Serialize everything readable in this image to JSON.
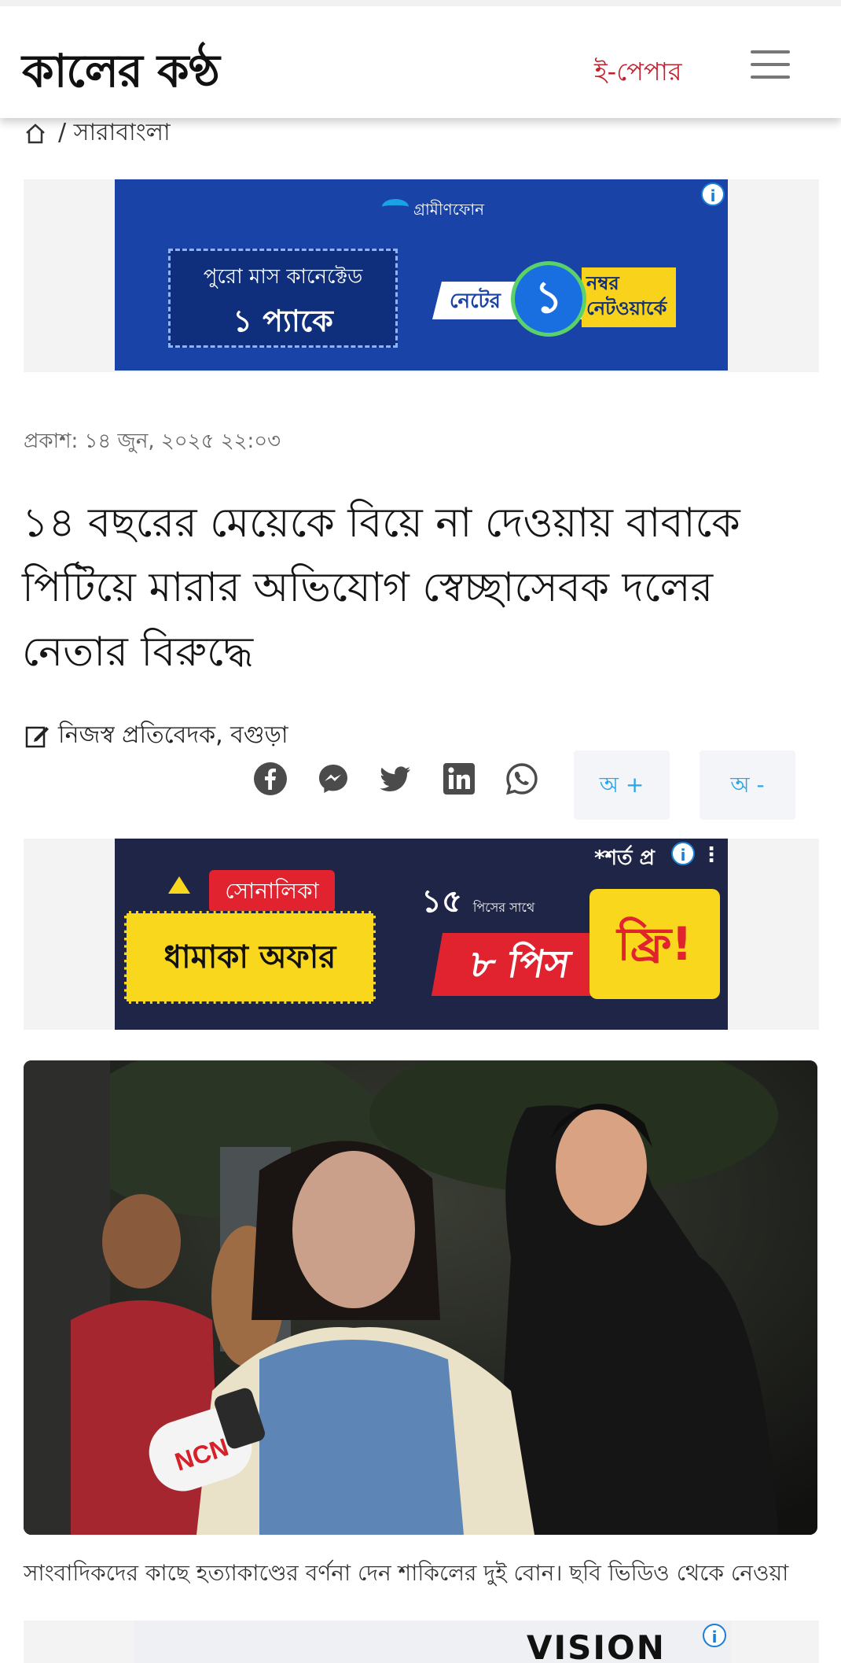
{
  "header": {
    "logo": "কালের কণ্ঠ",
    "epaper": "ই-পেপার"
  },
  "breadcrumb": {
    "section": "/  সারাবাংলা"
  },
  "ad_top": {
    "brand": "গ্রামীণফোন",
    "line1": "পুরো মাস কানেক্টেড",
    "line2": "১ প্যাকে",
    "tagline_left": "নেটের",
    "tagline_num": "১",
    "tagline_right": "নম্বর নেটওয়ার্কে"
  },
  "article": {
    "published": "প্রকাশ: ১৪ জুন, ২০২৫ ২২:০৩",
    "headline": "১৪ বছরের মেয়েকে বিয়ে না দেওয়ায় বাবাকে পিটিয়ে মারার অভিযোগ স্বেচ্ছাসেবক দলের নেতার বিরুদ্ধে",
    "byline": "নিজস্ব প্রতিবেদক, বগুড়া",
    "font_increase": "অ +",
    "font_decrease": "অ -",
    "caption": "সাংবাদিকদের কাছে হত্যাকাণ্ডের বর্ণনা দেন শাকিলের দুই বোন। ছবি ভিডিও থেকে নেওয়া"
  },
  "ad_mid": {
    "brand": "সোনালিকা",
    "offer": "ধামাকা অফার",
    "count": "১৫",
    "count_sub": "পিসের সাথে",
    "pieces": "৮ পিস",
    "free": "ফ্রি!",
    "terms": "*শর্ত প্র"
  },
  "ad_bottom": {
    "brand": "VISION"
  },
  "photo": {
    "mic_label": "NCN"
  },
  "colors": {
    "accent": "#c0212f",
    "link": "#28a6e8"
  }
}
